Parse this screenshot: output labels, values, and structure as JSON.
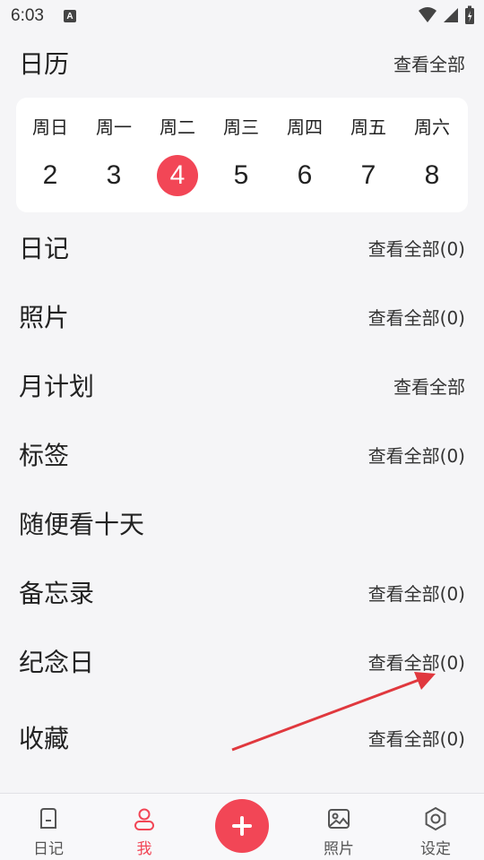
{
  "status_bar": {
    "time": "6:03",
    "notification_letter": "A"
  },
  "calendar": {
    "title": "日历",
    "view_all": "查看全部",
    "days": [
      {
        "weekday": "周日",
        "date": "2",
        "today": false
      },
      {
        "weekday": "周一",
        "date": "3",
        "today": false
      },
      {
        "weekday": "周二",
        "date": "4",
        "today": true
      },
      {
        "weekday": "周三",
        "date": "5",
        "today": false
      },
      {
        "weekday": "周四",
        "date": "6",
        "today": false
      },
      {
        "weekday": "周五",
        "date": "7",
        "today": false
      },
      {
        "weekday": "周六",
        "date": "8",
        "today": false
      }
    ]
  },
  "sections": [
    {
      "title": "日记",
      "link": "查看全部(0)"
    },
    {
      "title": "照片",
      "link": "查看全部(0)"
    },
    {
      "title": "月计划",
      "link": "查看全部"
    },
    {
      "title": "标签",
      "link": "查看全部(0)"
    },
    {
      "title": "随便看十天",
      "link": ""
    },
    {
      "title": "备忘录",
      "link": "查看全部(0)"
    },
    {
      "title": "纪念日",
      "link": "查看全部(0)"
    },
    {
      "title": "收藏",
      "link": "查看全部(0)"
    }
  ],
  "bottom_nav": {
    "items": [
      {
        "label": "日记",
        "icon": "diary-icon",
        "active": false
      },
      {
        "label": "我",
        "icon": "person-icon",
        "active": true
      },
      {
        "label": "照片",
        "icon": "image-icon",
        "active": false
      },
      {
        "label": "设定",
        "icon": "settings-icon",
        "active": false
      }
    ],
    "fab_icon": "plus-icon"
  },
  "colors": {
    "accent": "#f24656",
    "background": "#f5f5f7",
    "annotation_arrow": "#e0383e"
  }
}
